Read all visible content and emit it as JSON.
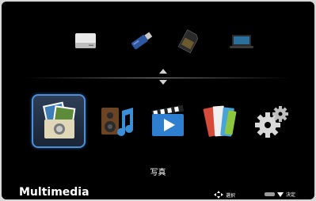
{
  "devices": [
    {
      "name": "hard-drive"
    },
    {
      "name": "usb-stick"
    },
    {
      "name": "sd-card"
    },
    {
      "name": "network-pc"
    }
  ],
  "apps": [
    {
      "name": "photo",
      "selected": true
    },
    {
      "name": "music",
      "selected": false
    },
    {
      "name": "video",
      "selected": false
    },
    {
      "name": "documents",
      "selected": false
    },
    {
      "name": "settings",
      "selected": false
    }
  ],
  "caption": "写真",
  "footer": {
    "title": "Multimedia",
    "hint_select_label": "選択",
    "hint_enter_label": "決定"
  },
  "colors": {
    "background": "#000000",
    "selection_border": "#4d8fd8",
    "text": "#ffffff"
  }
}
